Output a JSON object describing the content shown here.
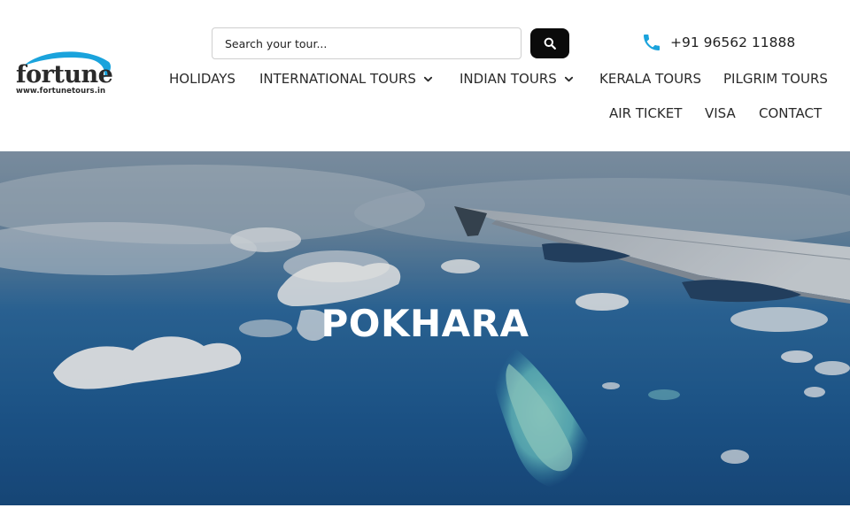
{
  "brand": {
    "name": "fortune",
    "url": "www.fortunetours.in",
    "accent_color": "#1aa3dc"
  },
  "search": {
    "placeholder": "Search your tour...",
    "button_icon": "search-icon"
  },
  "contact": {
    "phone": "+91 96562 11888",
    "icon": "phone-icon"
  },
  "nav": {
    "holidays": "HOLIDAYS",
    "international": "INTERNATIONAL TOURS",
    "indian": "INDIAN TOURS",
    "kerala": "KERALA TOURS",
    "pilgrim": "PILGRIM TOURS",
    "air_ticket": "AIR TICKET",
    "visa": "VISA",
    "contact": "CONTACT"
  },
  "hero": {
    "title": "POKHARA"
  }
}
